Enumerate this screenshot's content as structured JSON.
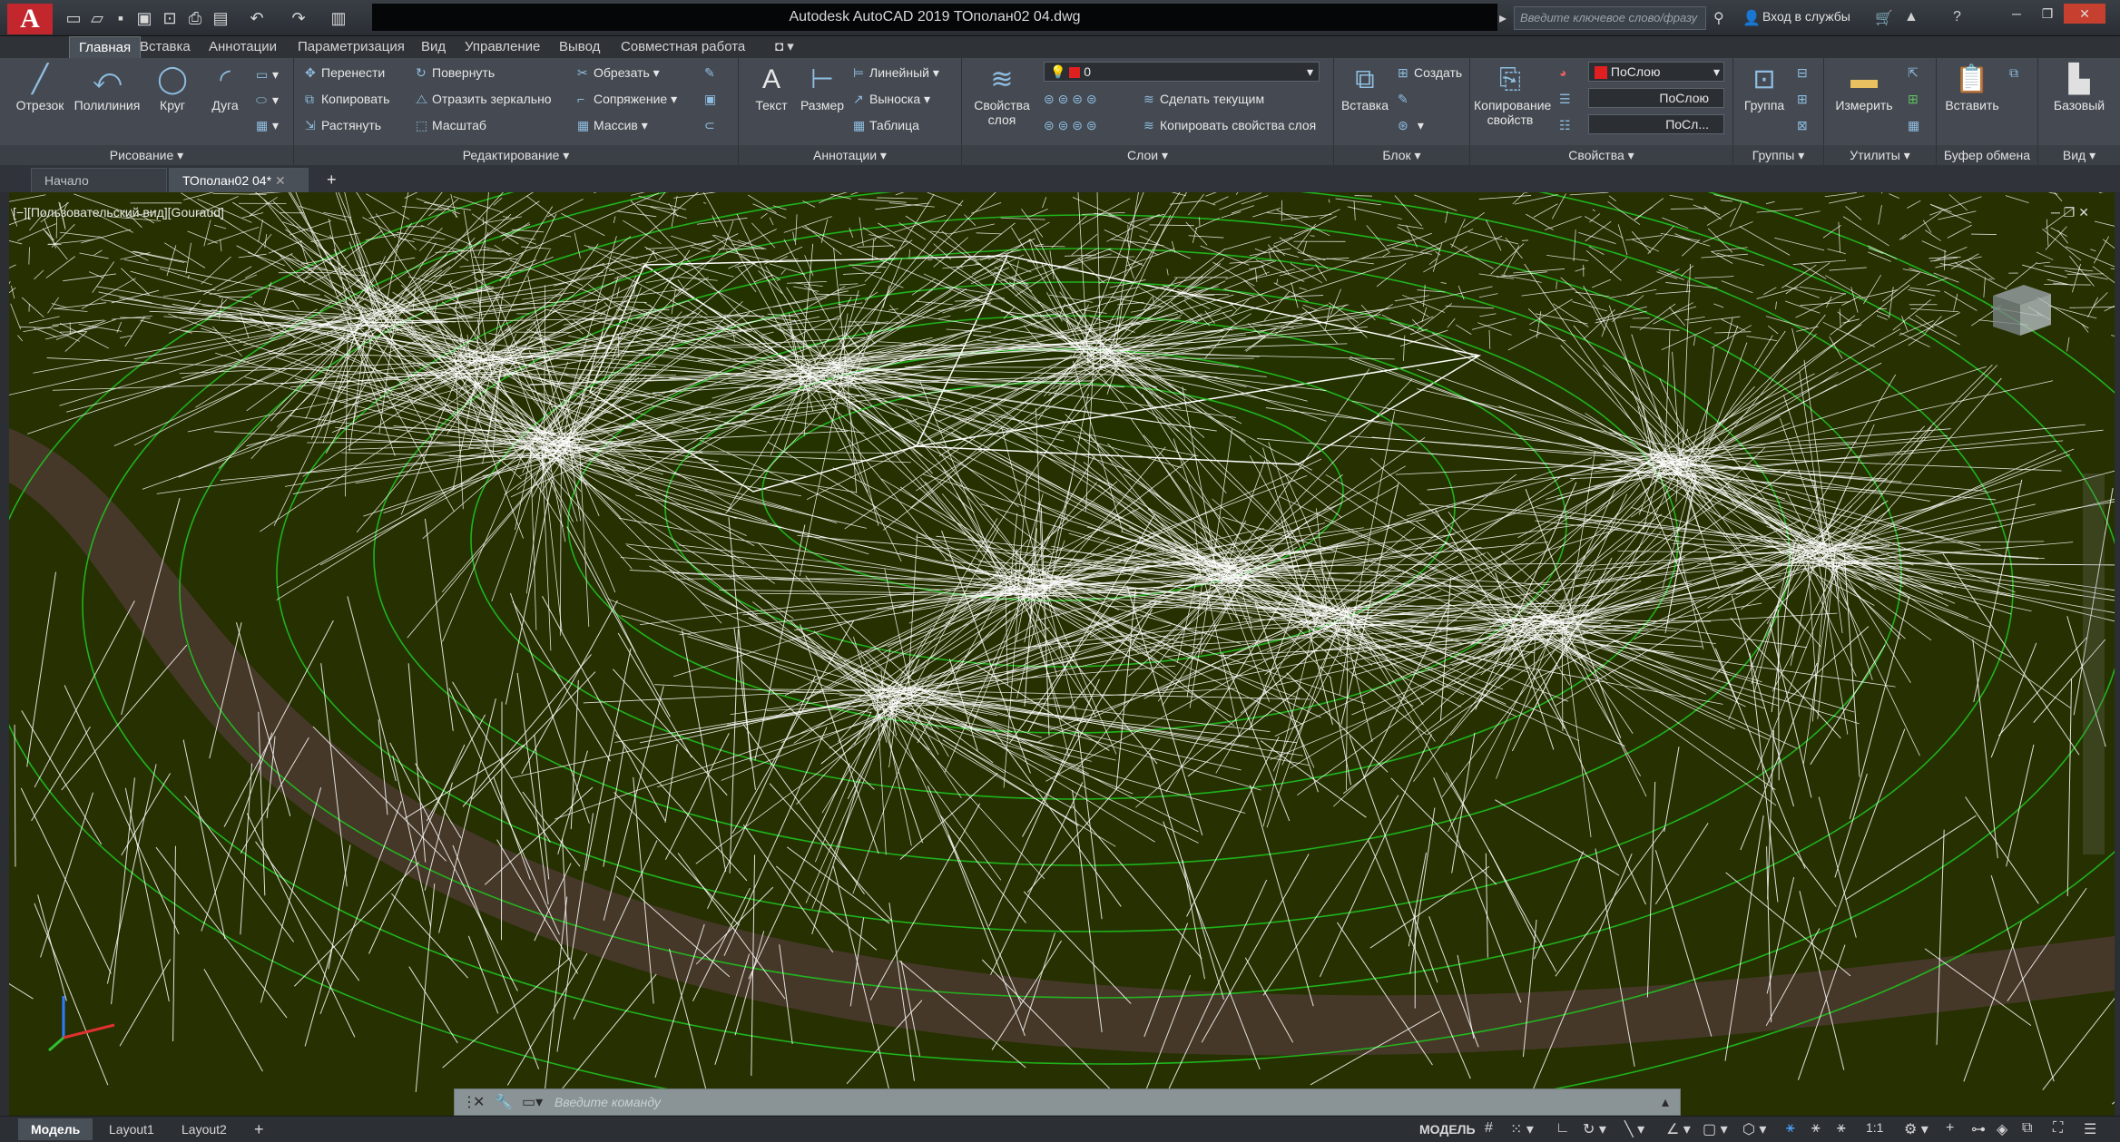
{
  "app": {
    "logo": "A",
    "title": "Autodesk AutoCAD 2019    ТОполан02 04.dwg"
  },
  "search": {
    "placeholder": "Введите ключевое слово/фразу"
  },
  "signin": "Вход в службы",
  "ribbon_tabs": [
    "Главная",
    "Вставка",
    "Аннотации",
    "Параметризация",
    "Вид",
    "Управление",
    "Вывод",
    "Совместная работа"
  ],
  "draw": {
    "title": "Рисование",
    "line": "Отрезок",
    "polyline": "Полилиния",
    "circle": "Круг",
    "arc": "Дуга"
  },
  "modify": {
    "title": "Редактирование",
    "move": "Перенести",
    "rotate": "Повернуть",
    "trim": "Обрезать",
    "copy": "Копировать",
    "mirror": "Отразить зеркально",
    "fillet": "Сопряжение",
    "stretch": "Растянуть",
    "scale": "Масштаб",
    "array": "Массив"
  },
  "annotation": {
    "title": "Аннотации",
    "text": "Текст",
    "dimension": "Размер",
    "linear": "Линейный",
    "leader": "Выноска",
    "table": "Таблица"
  },
  "layers": {
    "title": "Слои",
    "properties": "Свойства слоя",
    "current_layer": "0",
    "make_current": "Сделать текущим",
    "match_layer": "Копировать свойства слоя"
  },
  "block": {
    "title": "Блок",
    "insert": "Вставка",
    "create": "Создать"
  },
  "properties": {
    "title": "Свойства",
    "match": "Копирование свойств",
    "color": "ПоСлою",
    "linetype": "ПоСлою",
    "lineweight": "ПоСл..."
  },
  "groups": {
    "title": "Группы",
    "group": "Группа"
  },
  "utilities": {
    "title": "Утилиты",
    "measure": "Измерить"
  },
  "clipboard": {
    "title": "Буфер обмена",
    "paste": "Вставить"
  },
  "view": {
    "title": "Вид",
    "base": "Базовый"
  },
  "doc_tabs": {
    "start": "Начало",
    "current": "ТОполан02 04*"
  },
  "viewport": {
    "label": "[−][Пользовательский вид][Gouraud]"
  },
  "command": {
    "placeholder": "Введите команду"
  },
  "layout_tabs": [
    "Модель",
    "Layout1",
    "Layout2"
  ],
  "status": {
    "model": "МОДЕЛЬ",
    "scale": "1:1"
  },
  "colors": {
    "terrain": "#263000",
    "mesh": "#ffffff",
    "contour": "#1fc21f",
    "road": "#4a3a2c",
    "accent": "#c1272d"
  }
}
